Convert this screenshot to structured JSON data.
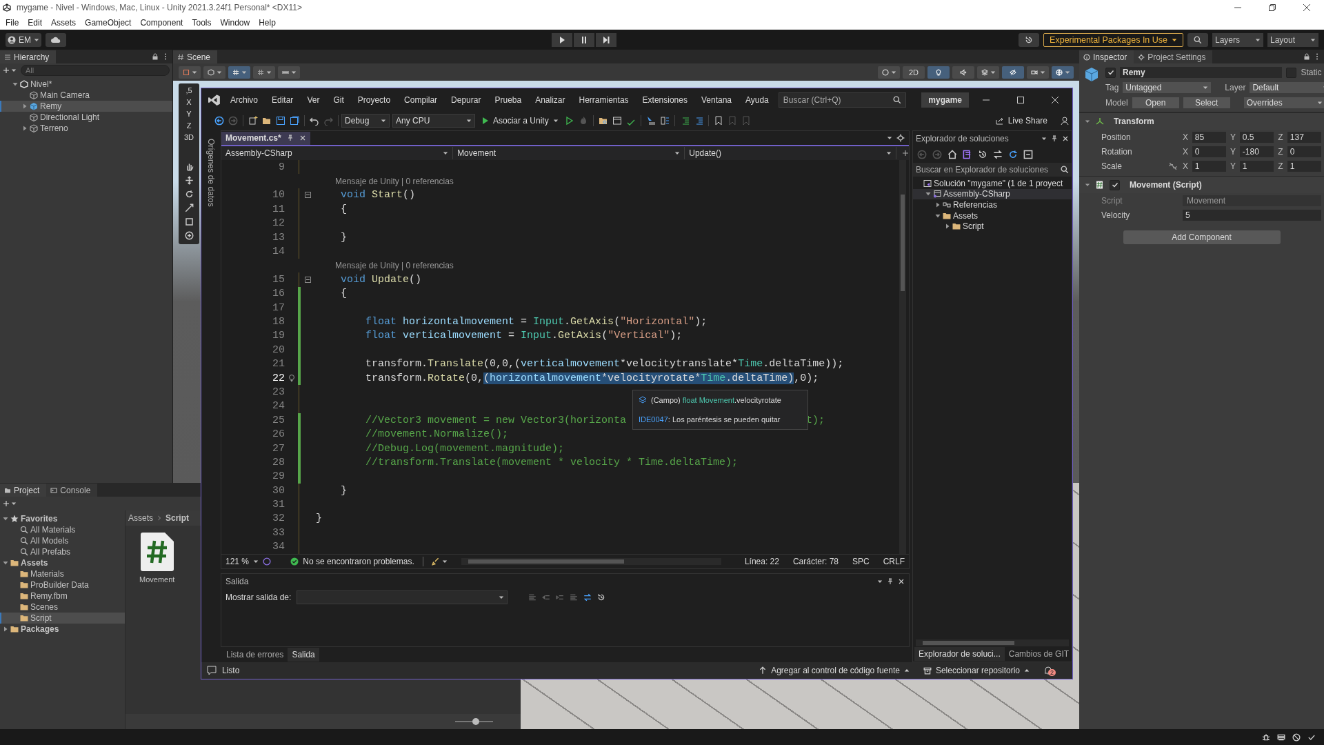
{
  "window": {
    "title": "mygame - Nivel - Windows, Mac, Linux - Unity 2021.3.24f1 Personal* <DX11>"
  },
  "menu": [
    "File",
    "Edit",
    "Assets",
    "GameObject",
    "Component",
    "Tools",
    "Window",
    "Help"
  ],
  "toolbar": {
    "account": "EM",
    "experimental": "Experimental Packages In Use",
    "layers": "Layers",
    "layout": "Layout"
  },
  "hierarchy": {
    "title": "Hierarchy",
    "search": {
      "placeholder": "All"
    },
    "items": [
      {
        "label": "Nivel*",
        "kind": "scene",
        "selected": false,
        "expandable": true,
        "expanded": true,
        "children": [
          {
            "label": "Main Camera",
            "kind": "object",
            "selected": false,
            "expandable": false,
            "expanded": false
          },
          {
            "label": "Remy",
            "kind": "prefab",
            "selected": true,
            "expandable": true,
            "expanded": false
          },
          {
            "label": "Directional Light",
            "kind": "object",
            "selected": false,
            "expandable": false,
            "expanded": false
          },
          {
            "label": "Terreno",
            "kind": "object",
            "selected": false,
            "expandable": true,
            "expanded": false
          }
        ]
      }
    ]
  },
  "scene": {
    "title": "Scene",
    "mode_2d": "2D",
    "lighting_on": true,
    "audio_on": false,
    "visibility_on": true,
    "overlay_labels": [
      ",5",
      "X",
      "Y",
      "Z",
      "3D"
    ]
  },
  "project": {
    "tabs": [
      {
        "label": "Project",
        "selected": true
      },
      {
        "label": "Console",
        "selected": false
      }
    ],
    "tree": [
      {
        "label": "Favorites",
        "kind": "favorites",
        "selected": false,
        "expandable": true,
        "expanded": true,
        "children": [
          {
            "label": "All Materials",
            "kind": "search",
            "selected": false,
            "expandable": false,
            "expanded": false
          },
          {
            "label": "All Models",
            "kind": "search",
            "selected": false,
            "expandable": false,
            "expanded": false
          },
          {
            "label": "All Prefabs",
            "kind": "search",
            "selected": false,
            "expandable": false,
            "expanded": false
          }
        ]
      },
      {
        "label": "Assets",
        "kind": "folder",
        "selected": false,
        "expandable": true,
        "expanded": true,
        "children": [
          {
            "label": "Materials",
            "kind": "folder",
            "selected": false,
            "expandable": false,
            "expanded": false
          },
          {
            "label": "ProBuilder Data",
            "kind": "folder",
            "selected": false,
            "expandable": false,
            "expanded": false
          },
          {
            "label": "Remy.fbm",
            "kind": "folder",
            "selected": false,
            "expandable": false,
            "expanded": false
          },
          {
            "label": "Scenes",
            "kind": "folder",
            "selected": false,
            "expandable": false,
            "expanded": false
          },
          {
            "label": "Script",
            "kind": "folder",
            "selected": true,
            "expandable": false,
            "expanded": false
          }
        ]
      },
      {
        "label": "Packages",
        "kind": "folder",
        "selected": false,
        "expandable": true,
        "expanded": false
      }
    ],
    "breadcrumb": [
      "Assets",
      "Script"
    ],
    "files": [
      {
        "label": "Movement",
        "kind": "script"
      }
    ],
    "icon_size": {
      "level": 0.55
    }
  },
  "inspector": {
    "tabs": [
      {
        "label": "Inspector",
        "selected": true
      },
      {
        "label": "Project Settings",
        "selected": false
      }
    ],
    "object": {
      "name": "Remy",
      "active": true,
      "static_label": "Static",
      "static": false,
      "tag_label": "Tag",
      "tag": "Untagged",
      "layer_label": "Layer",
      "layer": "Default",
      "model_label": "Model",
      "model_buttons": [
        "Open",
        "Select"
      ],
      "overrides": "Overrides"
    },
    "components": [
      {
        "kind": "transform",
        "title": "Transform",
        "rows": [
          {
            "label": "Position",
            "linked": false,
            "values": [
              {
                "axis": "X",
                "value": "85"
              },
              {
                "axis": "Y",
                "value": "0.5"
              },
              {
                "axis": "Z",
                "value": "137"
              }
            ]
          },
          {
            "label": "Rotation",
            "linked": false,
            "values": [
              {
                "axis": "X",
                "value": "0"
              },
              {
                "axis": "Y",
                "value": "-180"
              },
              {
                "axis": "Z",
                "value": "0"
              }
            ]
          },
          {
            "label": "Scale",
            "linked": true,
            "values": [
              {
                "axis": "X",
                "value": "1"
              },
              {
                "axis": "Y",
                "value": "1"
              },
              {
                "axis": "Z",
                "value": "1"
              }
            ]
          }
        ]
      },
      {
        "kind": "script",
        "title": "Movement (Script)",
        "enabled": true,
        "fields": [
          {
            "kind": "object",
            "label": "Script",
            "value": "Movement"
          },
          {
            "kind": "number",
            "label": "Velocity",
            "value": "5"
          }
        ]
      }
    ],
    "add_button": "Add Component"
  },
  "ide": {
    "menu": [
      "Archivo",
      "Editar",
      "Ver",
      "Git",
      "Proyecto",
      "Compilar",
      "Depurar",
      "Prueba",
      "Analizar",
      "Herramientas",
      "Extensiones",
      "Ventana",
      "Ayuda"
    ],
    "search": {
      "placeholder": "Buscar (Ctrl+Q)"
    },
    "solution_name": "mygame",
    "configuration": "Debug",
    "platform": "Any CPU",
    "attach": "Asociar a Unity",
    "live_share": "Live Share",
    "side_tab": "Orígenes de datos",
    "tabs": [
      {
        "label": "Movement.cs*",
        "selected": true
      }
    ],
    "nav": [
      "Assembly-CSharp",
      "Movement",
      "Update()"
    ],
    "code": [
      {
        "number": "9",
        "current": false,
        "changed": false
      },
      {
        "number": "10",
        "current": false,
        "changed": false,
        "codelens": "Mensaje de Unity | 0 referencias",
        "segments": [
          {
            "kind": "keyword",
            "text": "    void"
          },
          {
            "kind": "method",
            "text": " Start"
          },
          {
            "kind": "plain",
            "text": "()"
          }
        ]
      },
      {
        "number": "11",
        "current": false,
        "changed": false,
        "segments": [
          {
            "kind": "plain",
            "text": "    {"
          }
        ]
      },
      {
        "number": "12",
        "current": false,
        "changed": false
      },
      {
        "number": "13",
        "current": false,
        "changed": false,
        "segments": [
          {
            "kind": "plain",
            "text": "    }"
          }
        ]
      },
      {
        "number": "14",
        "current": false,
        "changed": false
      },
      {
        "number": "15",
        "current": false,
        "changed": false,
        "codelens": "Mensaje de Unity | 0 referencias",
        "segments": [
          {
            "kind": "keyword",
            "text": "    void"
          },
          {
            "kind": "method",
            "text": " Update"
          },
          {
            "kind": "plain",
            "text": "()"
          }
        ]
      },
      {
        "number": "16",
        "current": false,
        "changed": true,
        "segments": [
          {
            "kind": "plain",
            "text": "    {"
          }
        ]
      },
      {
        "number": "17",
        "current": false,
        "changed": true
      },
      {
        "number": "18",
        "current": false,
        "changed": true,
        "segments": [
          {
            "kind": "keyword",
            "text": "        float"
          },
          {
            "kind": "local",
            "text": " horizontalmovement"
          },
          {
            "kind": "plain",
            "text": " = "
          },
          {
            "kind": "type",
            "text": "Input"
          },
          {
            "kind": "plain",
            "text": "."
          },
          {
            "kind": "method",
            "text": "GetAxis"
          },
          {
            "kind": "plain",
            "text": "("
          },
          {
            "kind": "string",
            "text": "\"Horizontal\""
          },
          {
            "kind": "plain",
            "text": ");"
          }
        ]
      },
      {
        "number": "19",
        "current": false,
        "changed": true,
        "segments": [
          {
            "kind": "keyword",
            "text": "        float"
          },
          {
            "kind": "local",
            "text": " verticalmovement"
          },
          {
            "kind": "plain",
            "text": " = "
          },
          {
            "kind": "type",
            "text": "Input"
          },
          {
            "kind": "plain",
            "text": "."
          },
          {
            "kind": "method",
            "text": "GetAxis"
          },
          {
            "kind": "plain",
            "text": "("
          },
          {
            "kind": "string",
            "text": "\"Vertical\""
          },
          {
            "kind": "plain",
            "text": ");"
          }
        ]
      },
      {
        "number": "20",
        "current": false,
        "changed": true
      },
      {
        "number": "21",
        "current": false,
        "changed": true,
        "segments": [
          {
            "kind": "plain",
            "text": "        transform."
          },
          {
            "kind": "method",
            "text": "Translate"
          },
          {
            "kind": "plain",
            "text": "(0,0,("
          },
          {
            "kind": "local",
            "text": "verticalmovement"
          },
          {
            "kind": "plain",
            "text": "*velocitytranslate*"
          },
          {
            "kind": "type",
            "text": "Time"
          },
          {
            "kind": "plain",
            "text": ".deltaTime));"
          }
        ]
      },
      {
        "number": "22",
        "current": true,
        "changed": true,
        "segments": [
          {
            "kind": "plain",
            "text": "        transform."
          },
          {
            "kind": "method",
            "text": "Rotate"
          },
          {
            "kind": "plain",
            "text": "(0,"
          }
        ],
        "selection": [
          {
            "kind": "plain",
            "text": "("
          },
          {
            "kind": "local",
            "text": "horizontalmovement"
          },
          {
            "kind": "plain",
            "text": "*velocityrotate*"
          },
          {
            "kind": "type",
            "text": "Time"
          },
          {
            "kind": "plain",
            "text": ".deltaTime)"
          }
        ],
        "after": [
          {
            "kind": "plain",
            "text": ",0);"
          }
        ]
      },
      {
        "number": "23",
        "current": false,
        "changed": false
      },
      {
        "number": "24",
        "current": false,
        "changed": false
      },
      {
        "number": "25",
        "current": false,
        "changed": true,
        "segments": [
          {
            "kind": "comment",
            "text": "        //Vector3 movement = new Vector3(horizonta"
          },
          {
            "kind": "comment_tail",
            "text": "t);"
          }
        ]
      },
      {
        "number": "26",
        "current": false,
        "changed": true,
        "segments": [
          {
            "kind": "comment",
            "text": "        //movement.Normalize();"
          }
        ]
      },
      {
        "number": "27",
        "current": false,
        "changed": true,
        "segments": [
          {
            "kind": "comment",
            "text": "        //Debug.Log(movement.magnitude);"
          }
        ]
      },
      {
        "number": "28",
        "current": false,
        "changed": true,
        "segments": [
          {
            "kind": "comment",
            "text": "        //transform.Translate(movement * velocity * Time.deltaTime);"
          }
        ]
      },
      {
        "number": "29",
        "current": false,
        "changed": true
      },
      {
        "number": "30",
        "current": false,
        "changed": false,
        "segments": [
          {
            "kind": "plain",
            "text": "    }"
          }
        ]
      },
      {
        "number": "31",
        "current": false,
        "changed": false
      },
      {
        "number": "32",
        "current": false,
        "changed": false,
        "segments": [
          {
            "kind": "plain",
            "text": "}"
          }
        ]
      },
      {
        "number": "33",
        "current": false,
        "changed": false
      },
      {
        "number": "34",
        "current": false,
        "changed": false
      }
    ],
    "tooltip": {
      "signature": [
        {
          "kind": "plain",
          "text": "(Campo) "
        },
        {
          "kind": "type",
          "text": "float Movement"
        },
        {
          "kind": "plain",
          "text": ".velocityrotate"
        }
      ],
      "code": "IDE0047",
      "message": ": Los paréntesis se pueden quitar"
    },
    "editor_status": {
      "zoom": "121 %",
      "issues": "No se encontraron problemas.",
      "line": "Línea: 22",
      "char": "Carácter: 78",
      "spacing": "SPC",
      "eol": "CRLF"
    },
    "output": {
      "title": "Salida",
      "source_label": "Mostrar salida de:"
    },
    "bottom_tabs": [
      {
        "label": "Lista de errores",
        "selected": false
      },
      {
        "label": "Salida",
        "selected": true
      }
    ],
    "solution_explorer": {
      "title": "Explorador de soluciones",
      "search": {
        "placeholder": "Buscar en Explorador de soluciones"
      },
      "tree": [
        {
          "label": "Solución \"mygame\"  (1 de 1 proyect",
          "kind": "solution",
          "selected": false,
          "expandable": false,
          "expanded": true,
          "children": [
            {
              "label": "Assembly-CSharp",
              "kind": "project",
              "selected": true,
              "expandable": true,
              "expanded": true,
              "children": [
                {
                  "label": "Referencias",
                  "kind": "references",
                  "selected": false,
                  "expandable": true,
                  "expanded": false
                },
                {
                  "label": "Assets",
                  "kind": "folder",
                  "selected": false,
                  "expandable": true,
                  "expanded": true,
                  "children": [
                    {
                      "label": "Script",
                      "kind": "folder",
                      "selected": false,
                      "expandable": true,
                      "expanded": false
                    }
                  ]
                }
              ]
            }
          ]
        }
      ],
      "tabs": [
        {
          "label": "Explorador de soluci...",
          "selected": true
        },
        {
          "label": "Cambios de GIT",
          "selected": false
        }
      ]
    },
    "status": {
      "text": "Listo",
      "source_control": "Agregar al control de código fuente",
      "repository": "Seleccionar repositorio",
      "notifications": "2"
    }
  }
}
